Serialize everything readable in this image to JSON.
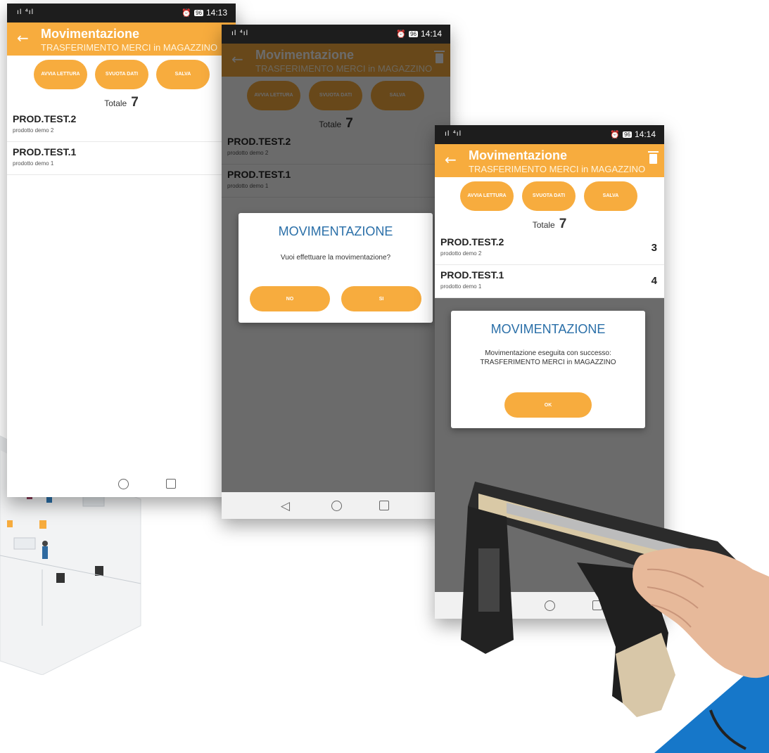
{
  "status": {
    "signal": "ıl ⁴ıl",
    "battery": "96",
    "time_left": "14:13",
    "time_mid": "14:14",
    "time_right": "14:14"
  },
  "app": {
    "title": "Movimentazione",
    "subtitle": "TRASFERIMENTO MERCI in MAGAZZINO"
  },
  "buttons": {
    "avvia": "AVVIA LETTURA",
    "svuota": "SVUOTA DATI",
    "salva": "SALVA"
  },
  "totale": {
    "label": "Totale",
    "value": "7"
  },
  "items": [
    {
      "code": "PROD.TEST.2",
      "desc": "prodotto demo 2",
      "qty": "3"
    },
    {
      "code": "PROD.TEST.1",
      "desc": "prodotto demo 1",
      "qty": "4"
    }
  ],
  "dialog_confirm": {
    "title": "MOVIMENTAZIONE",
    "message": "Vuoi effettuare la movimentazione?",
    "no": "NO",
    "si": "SI"
  },
  "dialog_success": {
    "title": "MOVIMENTAZIONE",
    "message_line1": "Movimentazione eseguita con successo:",
    "message_line2": "TRASFERIMENTO MERCI in MAGAZZINO",
    "ok": "OK"
  },
  "colors": {
    "accent": "#f7ac3e",
    "dialog_title": "#2a6fa8",
    "brand_blue": "#1677c9"
  }
}
